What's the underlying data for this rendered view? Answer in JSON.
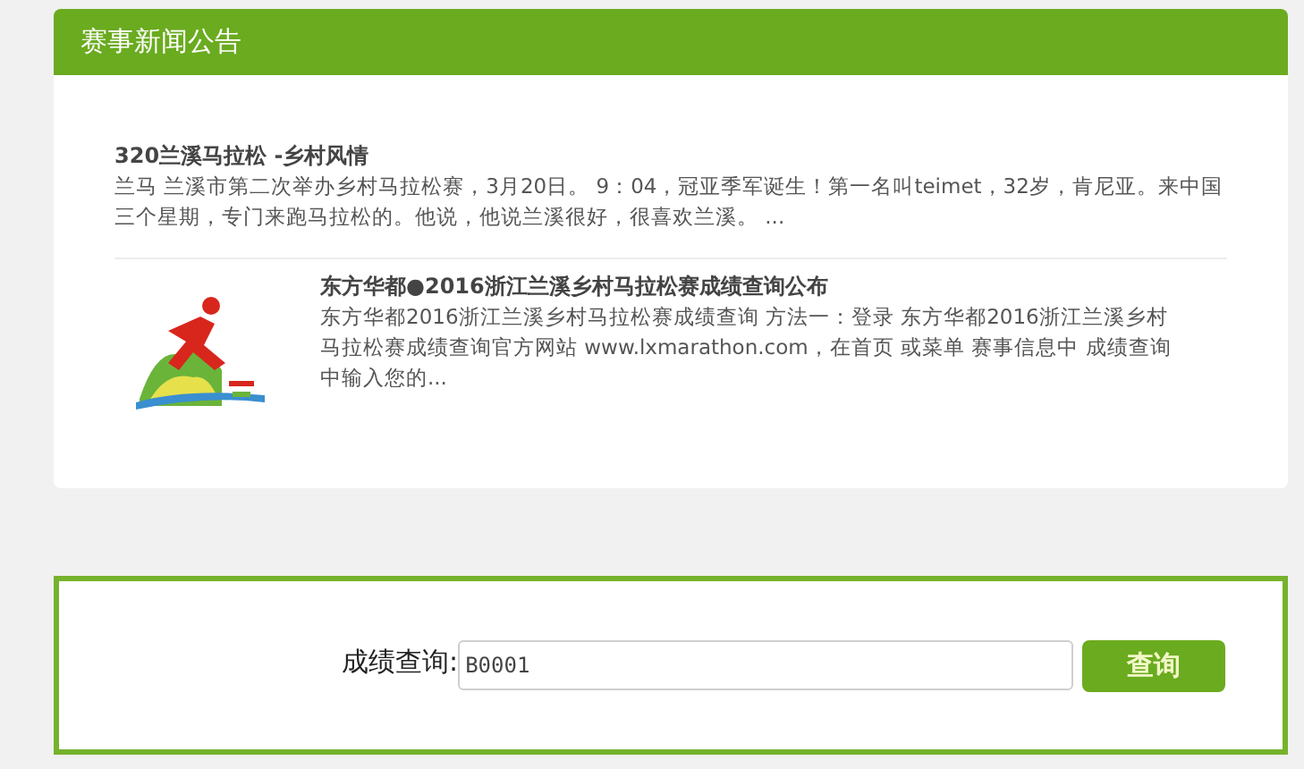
{
  "news_panel": {
    "title": "赛事新闻公告",
    "items": [
      {
        "kind": "text",
        "title": "320兰溪马拉松 -乡村风情",
        "summary": "兰马 兰溪市第二次举办乡村马拉松赛，3月20日。 9：04，冠亚季军诞生！第一名叫teimet，32岁，肯尼亚。来中国三个星期，专门来跑马拉松的。他说，他说兰溪很好，很喜欢兰溪。 ..."
      },
      {
        "title": "东方华都●2016浙江兰溪乡村马拉松赛成绩查询公布",
        "summary": "东方华都2016浙江兰溪乡村马拉松赛成绩查询 方法一：登录 东方华都2016浙江兰溪乡村马拉松赛成绩查询官方网站 www.lxmarathon.com，在首页 或菜单 赛事信息中 成绩查询中输入您的..."
      }
    ]
  },
  "query_form": {
    "label": "成绩查询:",
    "value": "B0001",
    "button": "查询"
  }
}
